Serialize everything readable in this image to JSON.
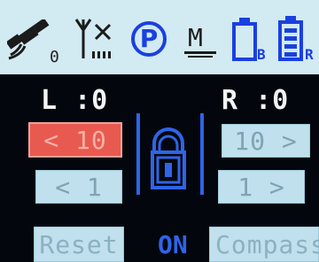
{
  "status_bar": {
    "icons": [
      "satellite-icon",
      "antenna-no-signal-icon",
      "parking-icon",
      "ground-icon",
      "battery-b-icon",
      "battery-r-icon"
    ],
    "satellite_count": "0",
    "parking_letter": "P",
    "ground_letter": "M",
    "battery_b_letter": "B",
    "battery_r_letter": "R"
  },
  "left": {
    "label": "L :0"
  },
  "right": {
    "label": "R :0"
  },
  "buttons": {
    "left_10": "< 10",
    "left_1": "< 1",
    "right_10": "10 >",
    "right_1": "1 >"
  },
  "bottom": {
    "reset": "Reset",
    "on": "ON",
    "compass": "Compass"
  },
  "colors": {
    "status_bg": "#d2eaf2",
    "accent_blue": "#2f64e8",
    "selected_red": "#e85a50"
  }
}
